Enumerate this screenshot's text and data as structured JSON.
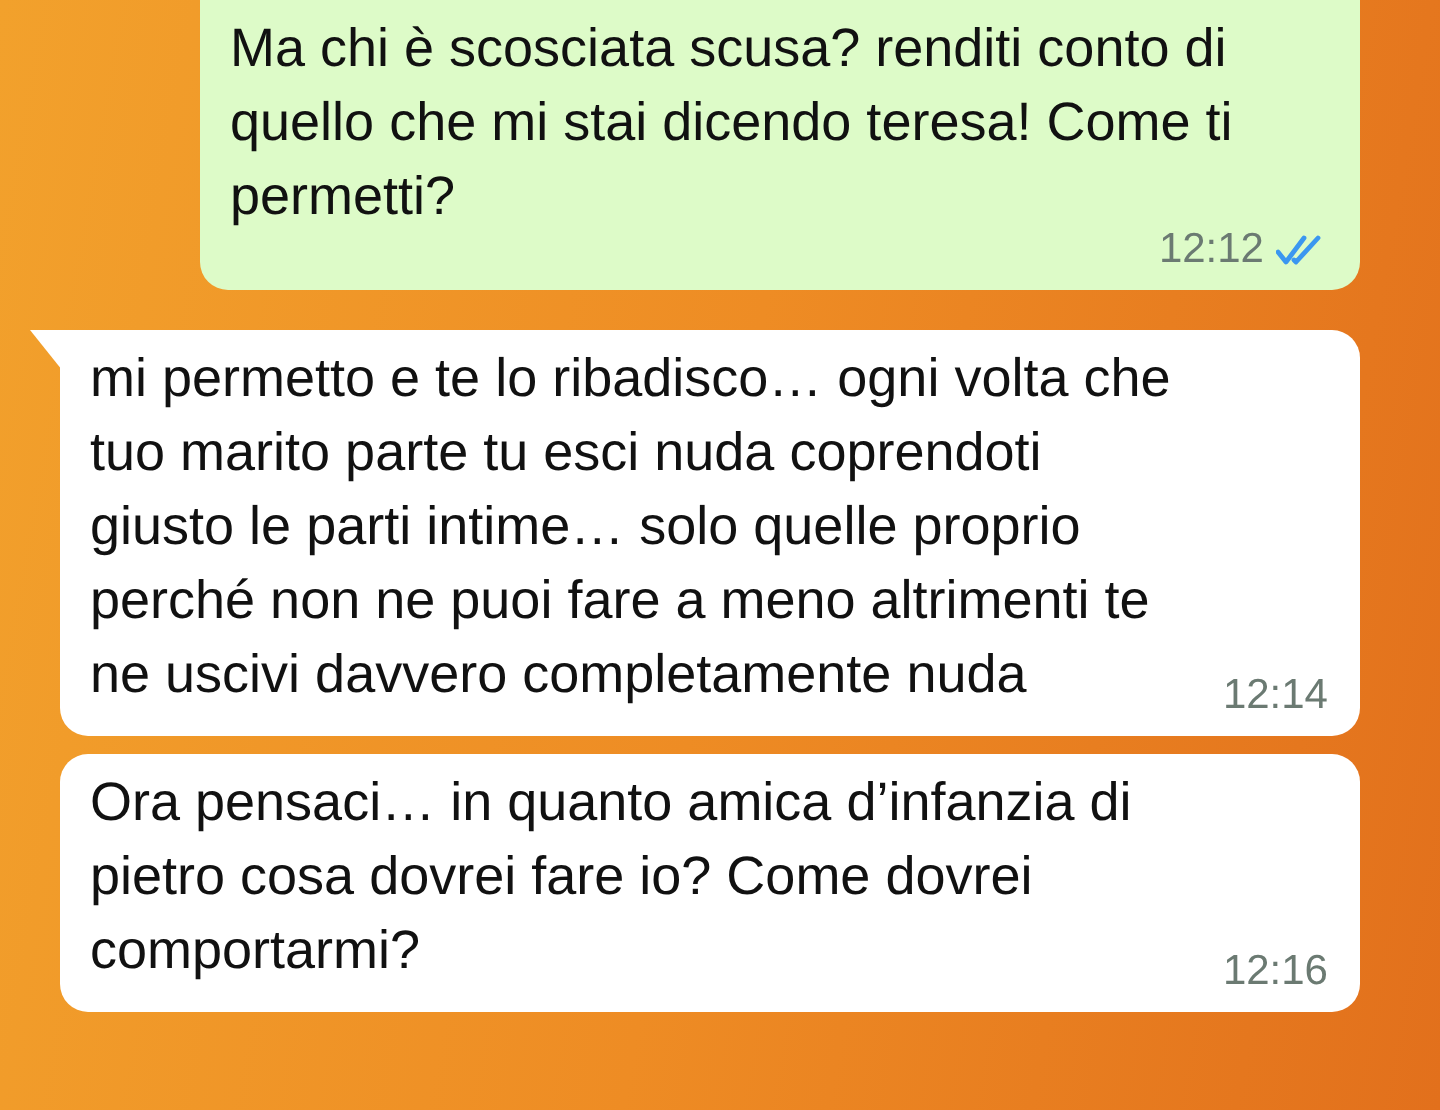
{
  "messages": [
    {
      "kind": "outgoing",
      "text": "Ma chi è scosciata scusa? renditi conto di quello che mi stai dicendo teresa! Come ti permetti?",
      "time": "12:12",
      "read": true,
      "tail": false
    },
    {
      "kind": "incoming",
      "text": "mi permetto e te lo ribadisco… ogni volta che tuo marito parte tu esci nuda coprendoti giusto le parti intime… solo quelle proprio perché non ne puoi fare a meno altrimenti te ne uscivi davvero completamente nuda",
      "time": "12:14",
      "tail": true
    },
    {
      "kind": "incoming",
      "text": "Ora pensaci… in quanto amica d’infanzia di pietro cosa dovrei fare io? Come dovrei comportarmi?",
      "time": "12:16",
      "tail": false
    }
  ]
}
